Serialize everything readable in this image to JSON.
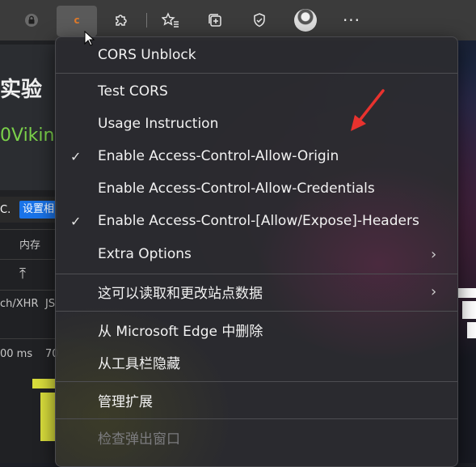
{
  "toolbar": {
    "icons": [
      "lock-icon",
      "cors-extension-icon",
      "puzzle-icon",
      "favorites-icon",
      "collections-icon",
      "browser-essentials-icon",
      "profile-avatar",
      "more-icon"
    ],
    "extension_letter": "c"
  },
  "background_page": {
    "heading": "实验",
    "green_text": "0Vikin",
    "devtools_button": "设置相",
    "devtools_partial": "C.",
    "memory_tab": "内存",
    "filter_text": "ch/XHR",
    "filter_text2": "JS",
    "time_text": "00 ms",
    "time_text2": "70"
  },
  "menu": {
    "items": [
      {
        "label": "CORS Unblock",
        "checked": false,
        "submenu": false,
        "disabled": false
      },
      {
        "label": "Test CORS",
        "checked": false,
        "submenu": false,
        "disabled": false
      },
      {
        "label": "Usage Instruction",
        "checked": false,
        "submenu": false,
        "disabled": false
      },
      {
        "label": "Enable Access-Control-Allow-Origin",
        "checked": true,
        "submenu": false,
        "disabled": false
      },
      {
        "label": "Enable Access-Control-Allow-Credentials",
        "checked": false,
        "submenu": false,
        "disabled": false
      },
      {
        "label": "Enable Access-Control-[Allow/Expose]-Headers",
        "checked": true,
        "submenu": false,
        "disabled": false
      },
      {
        "label": "Extra Options",
        "checked": false,
        "submenu": true,
        "disabled": false
      },
      {
        "label": "这可以读取和更改站点数据",
        "checked": false,
        "submenu": true,
        "disabled": false
      },
      {
        "label": "从 Microsoft Edge 中删除",
        "checked": false,
        "submenu": false,
        "disabled": false
      },
      {
        "label": "从工具栏隐藏",
        "checked": false,
        "submenu": false,
        "disabled": false
      },
      {
        "label": "管理扩展",
        "checked": false,
        "submenu": false,
        "disabled": false
      },
      {
        "label": "检查弹出窗口",
        "checked": false,
        "submenu": false,
        "disabled": true
      }
    ],
    "check_glyph": "✓",
    "chevron_glyph": "›"
  },
  "colors": {
    "menu_bg": "#2c2c30",
    "annotation_arrow": "#e8322e",
    "extension_icon": "#e07a2a"
  }
}
